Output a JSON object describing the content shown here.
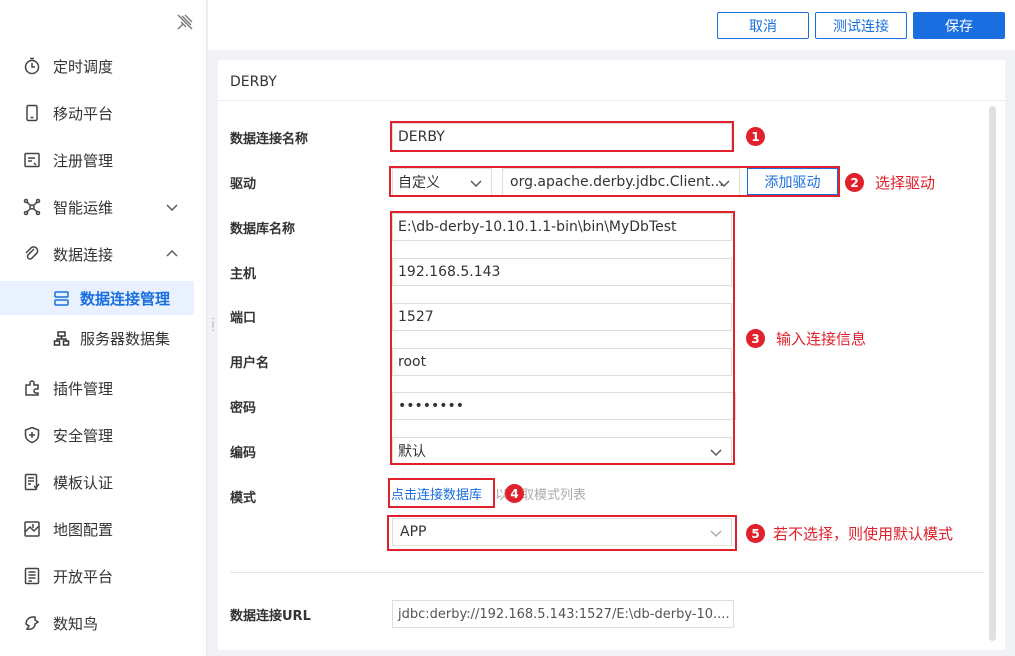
{
  "sidebar": {
    "items": [
      {
        "label": "定时调度",
        "icon": "timer-icon"
      },
      {
        "label": "移动平台",
        "icon": "mobile-icon"
      },
      {
        "label": "注册管理",
        "icon": "register-icon"
      },
      {
        "label": "智能运维",
        "icon": "ops-icon"
      },
      {
        "label": "数据连接",
        "icon": "link-icon"
      },
      {
        "label": "插件管理",
        "icon": "plugin-icon"
      },
      {
        "label": "安全管理",
        "icon": "shield-icon"
      },
      {
        "label": "模板认证",
        "icon": "template-icon"
      },
      {
        "label": "地图配置",
        "icon": "map-icon"
      },
      {
        "label": "开放平台",
        "icon": "open-platform-icon"
      },
      {
        "label": "数知鸟",
        "icon": "bird-icon"
      }
    ],
    "sub_items": [
      {
        "label": "数据连接管理",
        "icon": "db-manage-icon",
        "active": true
      },
      {
        "label": "服务器数据集",
        "icon": "server-dataset-icon",
        "active": false
      }
    ]
  },
  "toolbar": {
    "cancel_label": "取消",
    "test_label": "测试连接",
    "save_label": "保存"
  },
  "panel": {
    "title": "DERBY"
  },
  "form": {
    "name_label": "数据连接名称",
    "name_value": "DERBY",
    "driver_label": "驱动",
    "driver_type": "自定义",
    "driver_class": "org.apache.derby.jdbc.Client...",
    "add_driver_label": "添加驱动",
    "dbname_label": "数据库名称",
    "dbname_value": "E:\\db-derby-10.10.1.1-bin\\bin\\MyDbTest",
    "host_label": "主机",
    "host_value": "192.168.5.143",
    "port_label": "端口",
    "port_value": "1527",
    "user_label": "用户名",
    "user_value": "root",
    "password_label": "密码",
    "password_value": "••••••••",
    "encoding_label": "编码",
    "encoding_value": "默认",
    "schema_label": "模式",
    "schema_link": "点击连接数据库",
    "schema_hint": "以获取模式列表",
    "schema_value": "APP",
    "url_label": "数据连接URL",
    "url_value": "jdbc:derby://192.168.5.143:1527/E:\\db-derby-10...."
  },
  "annotations": {
    "b1": "1",
    "b2": "2",
    "b3": "3",
    "b4": "4",
    "b5": "5",
    "t2": "选择驱动",
    "t3": "输入连接信息",
    "t5": "若不选择，则使用默认模式",
    "color": "#e0202a"
  },
  "colors": {
    "accent": "#1a6fe0",
    "active_bg": "#e8f1fd"
  }
}
